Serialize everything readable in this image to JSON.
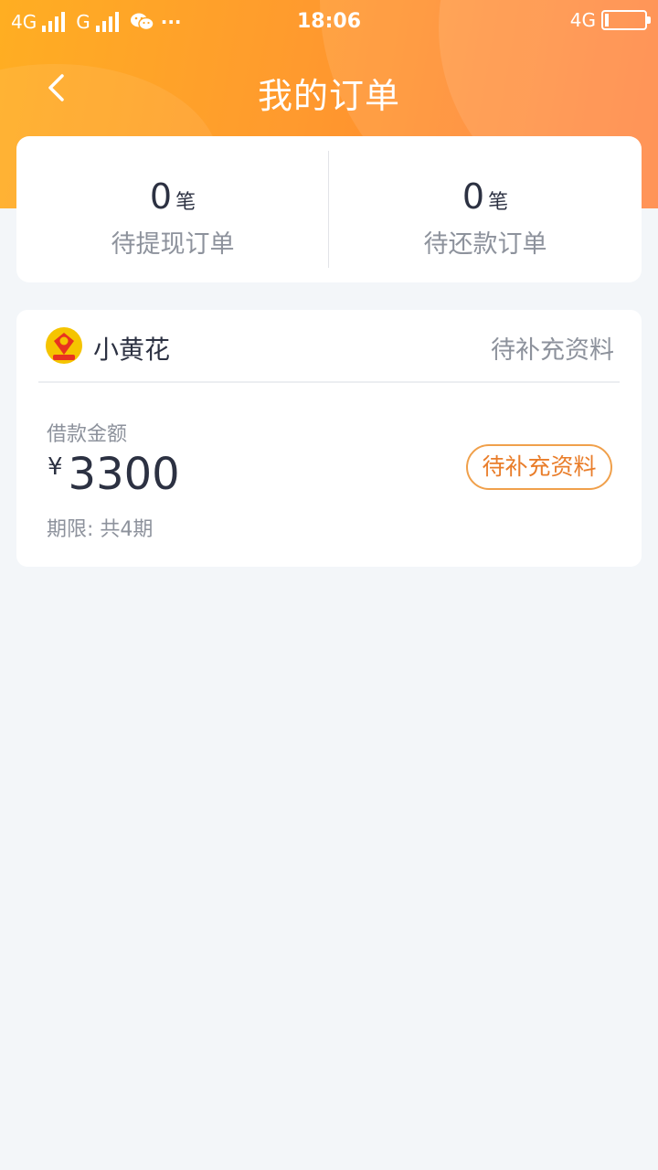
{
  "status_bar": {
    "network1": "4G",
    "network2": "G",
    "more": "···",
    "time": "18:06",
    "right_network": "4G"
  },
  "nav": {
    "title": "我的订单"
  },
  "summary": {
    "pending_withdraw": {
      "count": "0",
      "unit": "笔",
      "label": "待提现订单"
    },
    "pending_repay": {
      "count": "0",
      "unit": "笔",
      "label": "待还款订单"
    }
  },
  "order": {
    "brand": "小黄花",
    "status": "待补充资料",
    "amount_label": "借款金额",
    "currency": "¥",
    "amount": "3300",
    "term": "期限: 共4期",
    "action_label": "待补充资料"
  },
  "colors": {
    "header_start": "#ffae22",
    "header_end": "#ff7a32",
    "accent": "#e97d2a",
    "text_primary": "#2c3142",
    "text_secondary": "#8d929c",
    "background": "#f3f6f9"
  }
}
